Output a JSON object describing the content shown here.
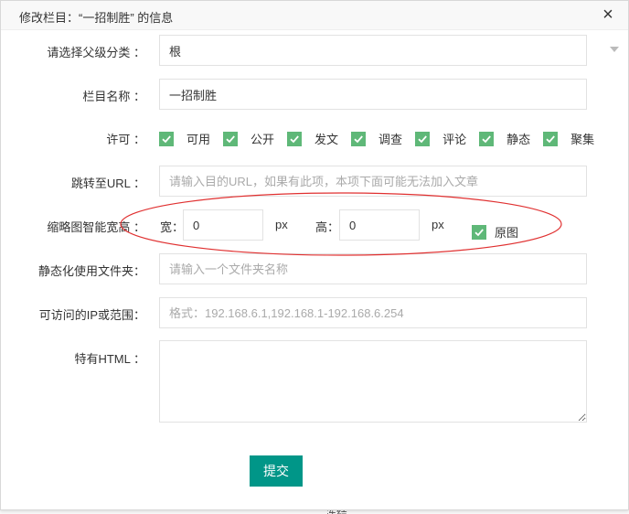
{
  "background": {
    "stub_text": "冻结"
  },
  "dialog": {
    "title": "修改栏目：“一招制胜” 的信息",
    "close_icon": "×"
  },
  "form": {
    "parent": {
      "label": "请选择父级分类 ：",
      "value": "根"
    },
    "name": {
      "label": "栏目名称 ：",
      "value": "一招制胜"
    },
    "permissions": {
      "label": "许可 ：",
      "options": [
        {
          "label": "可用",
          "checked": true
        },
        {
          "label": "公开",
          "checked": true
        },
        {
          "label": "发文",
          "checked": true
        },
        {
          "label": "调查",
          "checked": true
        },
        {
          "label": "评论",
          "checked": true
        },
        {
          "label": "静态",
          "checked": true
        },
        {
          "label": "聚集",
          "checked": true
        }
      ]
    },
    "redirect": {
      "label": "跳转至URL ：",
      "value": "",
      "placeholder": "请输入目的URL，如果有此项，本项下面可能无法加入文章"
    },
    "thumbnail": {
      "label": "缩略图智能宽高 ：",
      "width_label": "宽：",
      "width_value": "0",
      "width_unit": "px",
      "height_label": "高：",
      "height_value": "0",
      "height_unit": "px",
      "original_label": "原图",
      "original_checked": true
    },
    "static_folder": {
      "label": "静态化使用文件夹：",
      "value": "",
      "placeholder": "请输入一个文件夹名称"
    },
    "ip_range": {
      "label": "可访问的IP或范围：",
      "value": "",
      "placeholder": "格式：192.168.6.1,192.168.1-192.168.6.254"
    },
    "html": {
      "label": "特有HTML ：",
      "value": ""
    },
    "submit_label": "提交"
  },
  "annotation": {
    "color": "#e03030"
  },
  "colors": {
    "checkbox": "#5fb878",
    "submit": "#009688"
  }
}
